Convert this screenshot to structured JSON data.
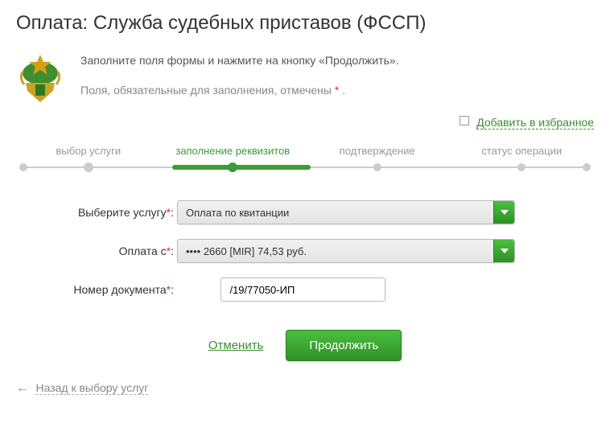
{
  "title": "Оплата: Служба судебных приставов (ФССП)",
  "header": {
    "instruction": "Заполните поля формы и нажмите на кнопку «Продолжить».",
    "required_note_prefix": "Поля, обязательные для заполнения, отмечены ",
    "required_note_suffix": " ."
  },
  "favorites": {
    "label": "Добавить в избранное"
  },
  "steps": {
    "items": [
      {
        "label": "выбор услуги",
        "state": "done"
      },
      {
        "label": "заполнение реквизитов",
        "state": "active"
      },
      {
        "label": "подтверждение",
        "state": "pending"
      },
      {
        "label": "статус операции",
        "state": "pending"
      }
    ]
  },
  "form": {
    "service": {
      "label": "Выберите услугу",
      "value": "Оплата по квитанции"
    },
    "pay_from": {
      "label": "Оплата с",
      "value": "•••• 2660 [MIR] 74,53 руб."
    },
    "doc_number": {
      "label": "Номер документа",
      "value": "/19/77050-ИП"
    }
  },
  "actions": {
    "cancel": "Отменить",
    "continue": "Продолжить",
    "back": "Назад к выбору услуг"
  },
  "asterisk": "*",
  "colon": ":"
}
